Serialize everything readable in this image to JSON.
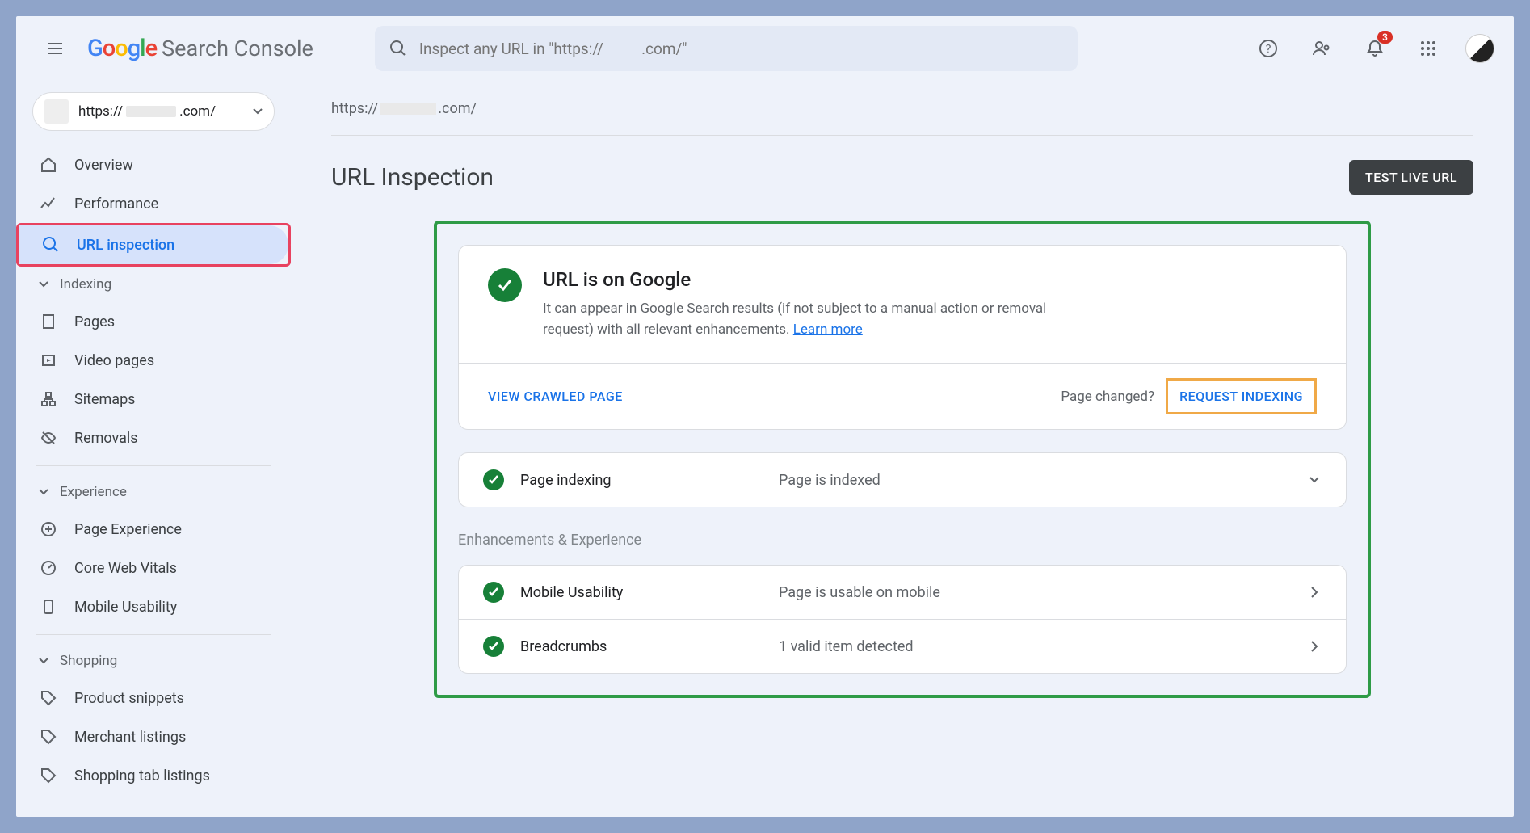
{
  "header": {
    "product": "Search Console",
    "search_placeholder": "Inspect any URL in \"https://          .com/\"",
    "notification_count": "3"
  },
  "property": {
    "url_prefix": "https://",
    "url_suffix": ".com/"
  },
  "sidebar": {
    "items": [
      {
        "label": "Overview"
      },
      {
        "label": "Performance"
      },
      {
        "label": "URL inspection"
      }
    ],
    "groups": [
      {
        "title": "Indexing",
        "items": [
          {
            "label": "Pages"
          },
          {
            "label": "Video pages"
          },
          {
            "label": "Sitemaps"
          },
          {
            "label": "Removals"
          }
        ]
      },
      {
        "title": "Experience",
        "items": [
          {
            "label": "Page Experience"
          },
          {
            "label": "Core Web Vitals"
          },
          {
            "label": "Mobile Usability"
          }
        ]
      },
      {
        "title": "Shopping",
        "items": [
          {
            "label": "Product snippets"
          },
          {
            "label": "Merchant listings"
          },
          {
            "label": "Shopping tab listings"
          }
        ]
      }
    ]
  },
  "breadcrumb": {
    "prefix": "https://",
    "suffix": ".com/"
  },
  "page": {
    "heading": "URL Inspection",
    "test_btn": "TEST LIVE URL"
  },
  "summary": {
    "title": "URL is on Google",
    "desc": "It can appear in Google Search results (if not subject to a manual action or removal request) with all relevant enhancements. ",
    "learn_more": "Learn more",
    "view_crawled": "VIEW CRAWLED PAGE",
    "page_changed": "Page changed?",
    "request_indexing": "REQUEST INDEXING"
  },
  "rows": {
    "indexing": {
      "label": "Page indexing",
      "value": "Page is indexed"
    },
    "section_label": "Enhancements & Experience",
    "mobile": {
      "label": "Mobile Usability",
      "value": "Page is usable on mobile"
    },
    "breadcrumbs": {
      "label": "Breadcrumbs",
      "value": "1 valid item detected"
    }
  }
}
